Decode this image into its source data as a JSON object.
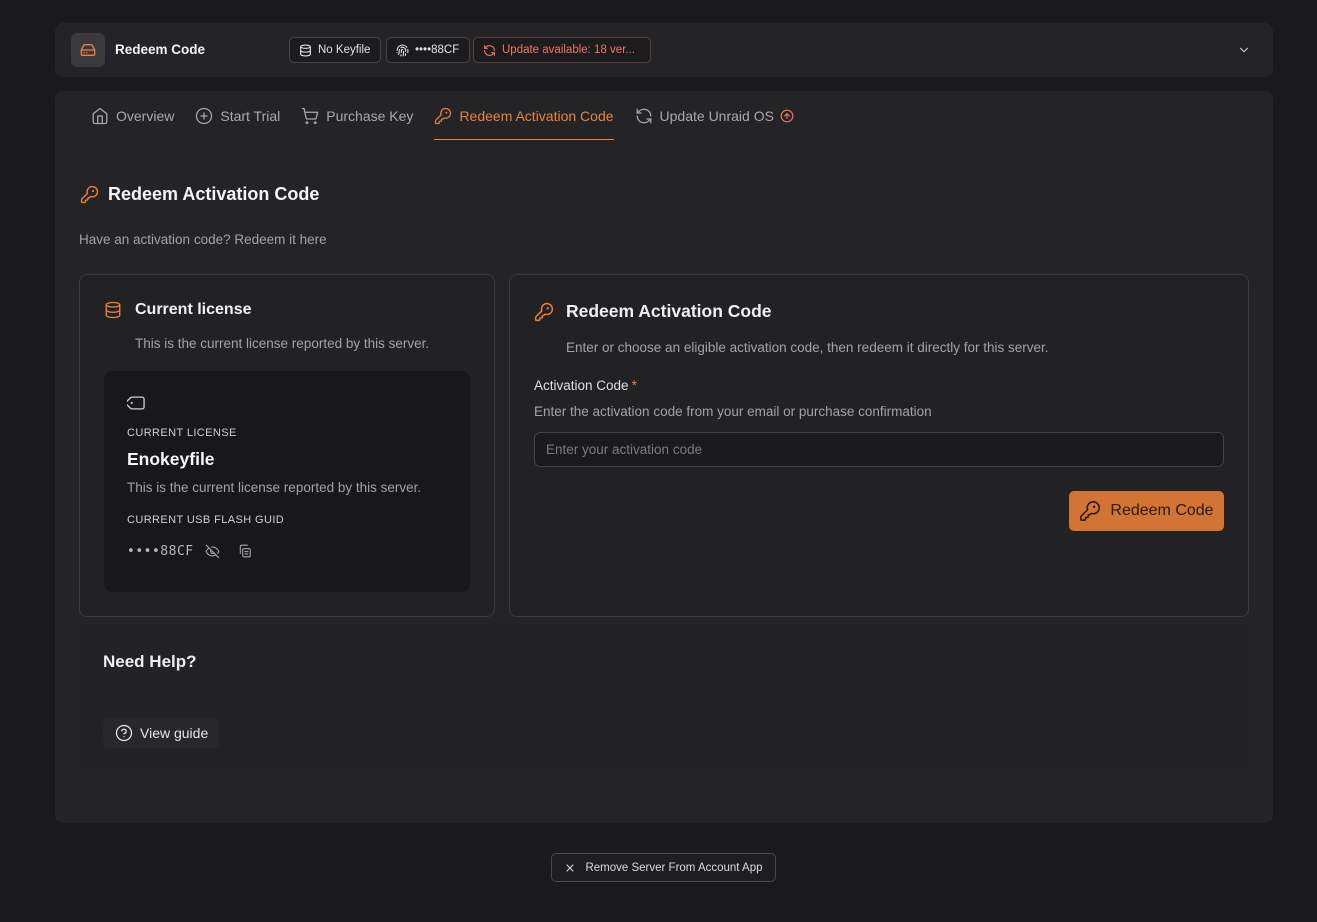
{
  "header": {
    "server_name": "Redeem Code",
    "keyfile_pill": "No Keyfile",
    "guid_pill": "••••88CF",
    "update_pill": "Update available: 18 ver..."
  },
  "tabs": [
    {
      "label": "Overview",
      "icon": "home-icon"
    },
    {
      "label": "Start Trial",
      "icon": "plus-circle-icon"
    },
    {
      "label": "Purchase Key",
      "icon": "cart-icon"
    },
    {
      "label": "Redeem Activation Code",
      "icon": "key-icon",
      "active": true
    },
    {
      "label": "Update Unraid OS",
      "icon": "refresh-icon"
    }
  ],
  "page": {
    "title": "Redeem Activation Code",
    "subtitle": "Have an activation code? Redeem it here"
  },
  "license_card": {
    "title": "Current license",
    "description": "This is the current license reported by this server.",
    "box": {
      "label": "CURRENT LICENSE",
      "name": "Enokeyfile",
      "description": "This is the current license reported by this server.",
      "guid_label": "CURRENT USB FLASH GUID",
      "guid_value": "••••88CF"
    }
  },
  "redeem_card": {
    "title": "Redeem Activation Code",
    "description": "Enter or choose an eligible activation code, then redeem it directly for this server.",
    "field_label": "Activation Code",
    "required_mark": "*",
    "field_help": "Enter the activation code from your email or purchase confirmation",
    "input_value": "",
    "input_placeholder": "Enter your activation code",
    "submit_label": "Redeem Code"
  },
  "help": {
    "title": "Need Help?",
    "guide_label": "View guide"
  },
  "footer": {
    "remove_label": "Remove Server From Account App"
  },
  "colors": {
    "accent": "#e8823f",
    "button": "#d27433",
    "warning": "#f27367",
    "background": "#1a1a1c",
    "panel": "#242427"
  }
}
